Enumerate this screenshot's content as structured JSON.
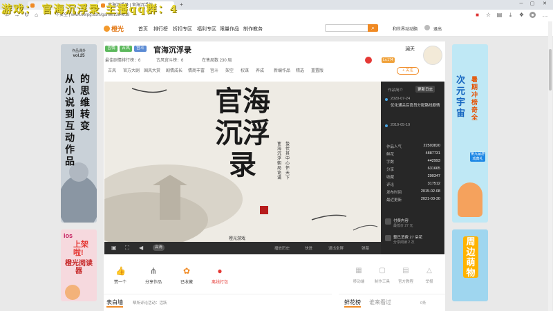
{
  "overlay": {
    "text": "游戏： 官海沉浮录  主播qq群：4"
  },
  "browser": {
    "tabs": [
      "",
      "官海沉浮录 | 官海沉浮作..."
    ],
    "url": "不安全 | www.66rpg.com/game/1394818"
  },
  "nav": {
    "logo": "橙光",
    "links": [
      "首页",
      "排行榜",
      "折扣专区",
      "福利专区",
      "限量作品",
      "制作教务"
    ],
    "search_placeholder": "",
    "right_links": [
      "和世界动动脑",
      "退出"
    ]
  },
  "game": {
    "tags": [
      "言情",
      "古风",
      "宫斗"
    ],
    "title": "官海沉浮录",
    "author": "澜天",
    "meta": [
      "最佳剧情排行榜：6",
      "古风宫斗榜：6",
      "在售局数 230 局"
    ],
    "follow_label": "+ 关注",
    "level_badge": "Lv.174",
    "subtabs": [
      "古风",
      "官方大剧",
      "国风大赏",
      "剧情成长",
      "情商丰富",
      "宫斗",
      "架空",
      "权谋",
      "养成",
      "新编作品",
      "精选",
      "重置版"
    ]
  },
  "panel": {
    "tabs": [
      "作品简介",
      "更新日志"
    ],
    "updates": [
      {
        "date": "2020-07-24",
        "text": "优化通关后官员分配路线剧情"
      },
      {
        "date": "2019-05-19",
        "text": ""
      }
    ],
    "stats": [
      {
        "label": "作品人气",
        "value": "22503820"
      },
      {
        "label": "鲜花",
        "value": "4887731"
      },
      {
        "label": "字数",
        "value": "442993"
      },
      {
        "label": "分享",
        "value": "631665"
      },
      {
        "label": "收藏",
        "value": "290347"
      },
      {
        "label": "评论",
        "value": "317512"
      },
      {
        "label": "发布时间",
        "value": "2015-02-08"
      },
      {
        "label": "最近更新",
        "value": "2021-03-30"
      }
    ],
    "paid": {
      "title": "付费内容",
      "sub": "最低价 27 元"
    },
    "vip": {
      "title": "整已消费 27 朵花",
      "sub": "分享阅读 2 次"
    }
  },
  "hero": {
    "calligraphy": "官海沉浮录",
    "subtitle": "橙光游戏",
    "poem_left": "宦海沉浮 朝局诡谲",
    "poem_right": "蛰伏其中 心怀天下"
  },
  "controls": {
    "speed": "高清",
    "right_items": [
      "播放历史",
      "快进",
      "退出全屏",
      "弹幕"
    ]
  },
  "actions": [
    {
      "icon": "thumb-up-icon",
      "label": "赞一个"
    },
    {
      "icon": "share-icon",
      "label": "分享作品"
    },
    {
      "icon": "bookmark-icon",
      "label": "已收藏"
    },
    {
      "icon": "download-icon",
      "label": "离线打包"
    }
  ],
  "actions_right": [
    "移动端",
    "制作工具",
    "官方教程",
    "举报"
  ],
  "tabs_bottom": {
    "left": "表白墙",
    "left_sub": "帮所评论活动：活跃",
    "right": [
      "鲜花榜",
      "谁来看过"
    ],
    "count": "0条"
  },
  "ads": {
    "left_top": {
      "lines": [
        "从小说到互动作品",
        "的思维转变"
      ],
      "corner": "作品课外",
      "vol": "vol.25"
    },
    "left_bottom": {
      "lines": [
        "橙光阅读器"
      ],
      "tag": "ios",
      "badge": "上架啦!"
    },
    "right_top": {
      "lines": [
        "次元宇宙",
        "暑期冲榜奇全"
      ],
      "badge": "第九届游戏典礼"
    },
    "right_bottom": {
      "lines": [
        "周边萌物"
      ]
    }
  },
  "colors": {
    "accent": "#f08a24",
    "panel_bg": "#272727"
  }
}
